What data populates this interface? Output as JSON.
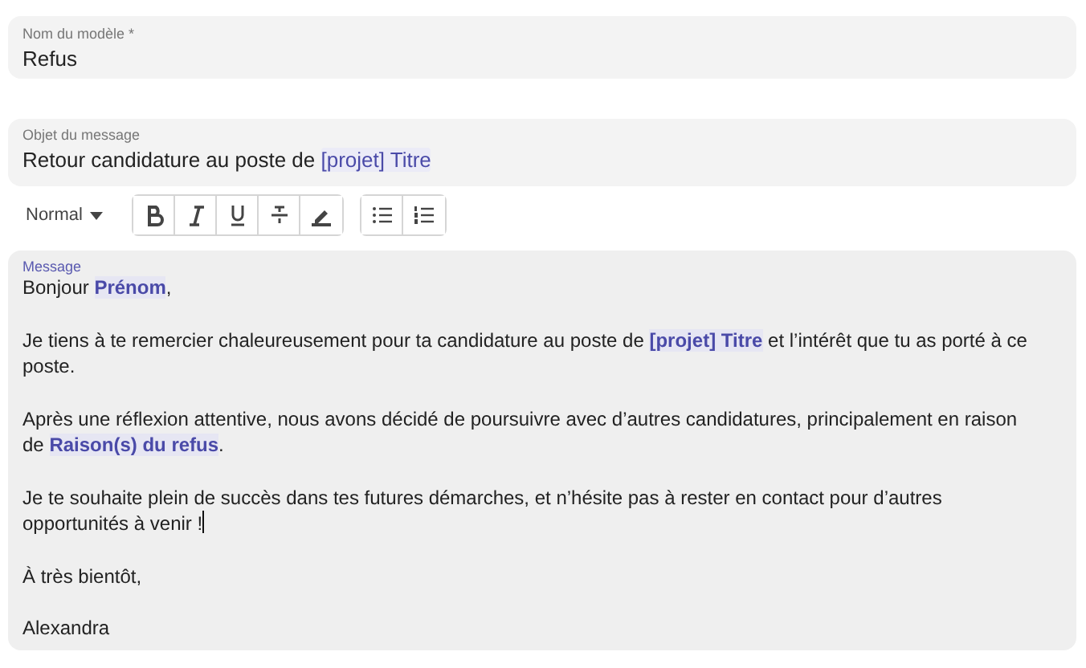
{
  "template_name": {
    "label": "Nom du modèle *",
    "value": "Refus"
  },
  "subject": {
    "label": "Objet du message",
    "segments": [
      {
        "kind": "text",
        "text": "Retour candidature au poste de "
      },
      {
        "kind": "variable",
        "text": "[projet] Titre"
      }
    ]
  },
  "toolbar": {
    "style_select": "Normal",
    "format_buttons": [
      {
        "kind": "bold"
      },
      {
        "kind": "italic"
      },
      {
        "kind": "underline"
      },
      {
        "kind": "strike"
      },
      {
        "kind": "highlight"
      }
    ],
    "list_buttons": [
      {
        "kind": "bullet"
      },
      {
        "kind": "ordered"
      }
    ]
  },
  "message": {
    "label": "Message",
    "paragraphs": [
      {
        "has_cursor": false,
        "segments": [
          {
            "kind": "text",
            "text": "Bonjour "
          },
          {
            "kind": "variable",
            "text": "Prénom"
          },
          {
            "kind": "text",
            "text": ","
          }
        ]
      },
      {
        "has_cursor": false,
        "segments": [
          {
            "kind": "text",
            "text": "Je tiens à te remercier chaleureusement pour ta candidature au poste de "
          },
          {
            "kind": "variable",
            "text": "[projet] Titre"
          },
          {
            "kind": "text",
            "text": " et l’intérêt que tu as porté à ce poste."
          }
        ]
      },
      {
        "has_cursor": false,
        "segments": [
          {
            "kind": "text",
            "text": "Après une réflexion attentive, nous avons décidé de poursuivre avec d’autres candidatures, principalement en raison de "
          },
          {
            "kind": "variable",
            "text": "Raison(s) du refus"
          },
          {
            "kind": "text",
            "text": "."
          }
        ]
      },
      {
        "has_cursor": true,
        "segments": [
          {
            "kind": "text",
            "text": "Je te souhaite plein de succès dans tes futures démarches, et n’hésite pas à rester en contact pour d’autres opportunités à venir !"
          }
        ]
      },
      {
        "has_cursor": false,
        "segments": [
          {
            "kind": "text",
            "text": "À très bientôt,"
          }
        ]
      },
      {
        "has_cursor": false,
        "segments": [
          {
            "kind": "text",
            "text": "Alexandra"
          }
        ]
      }
    ]
  }
}
